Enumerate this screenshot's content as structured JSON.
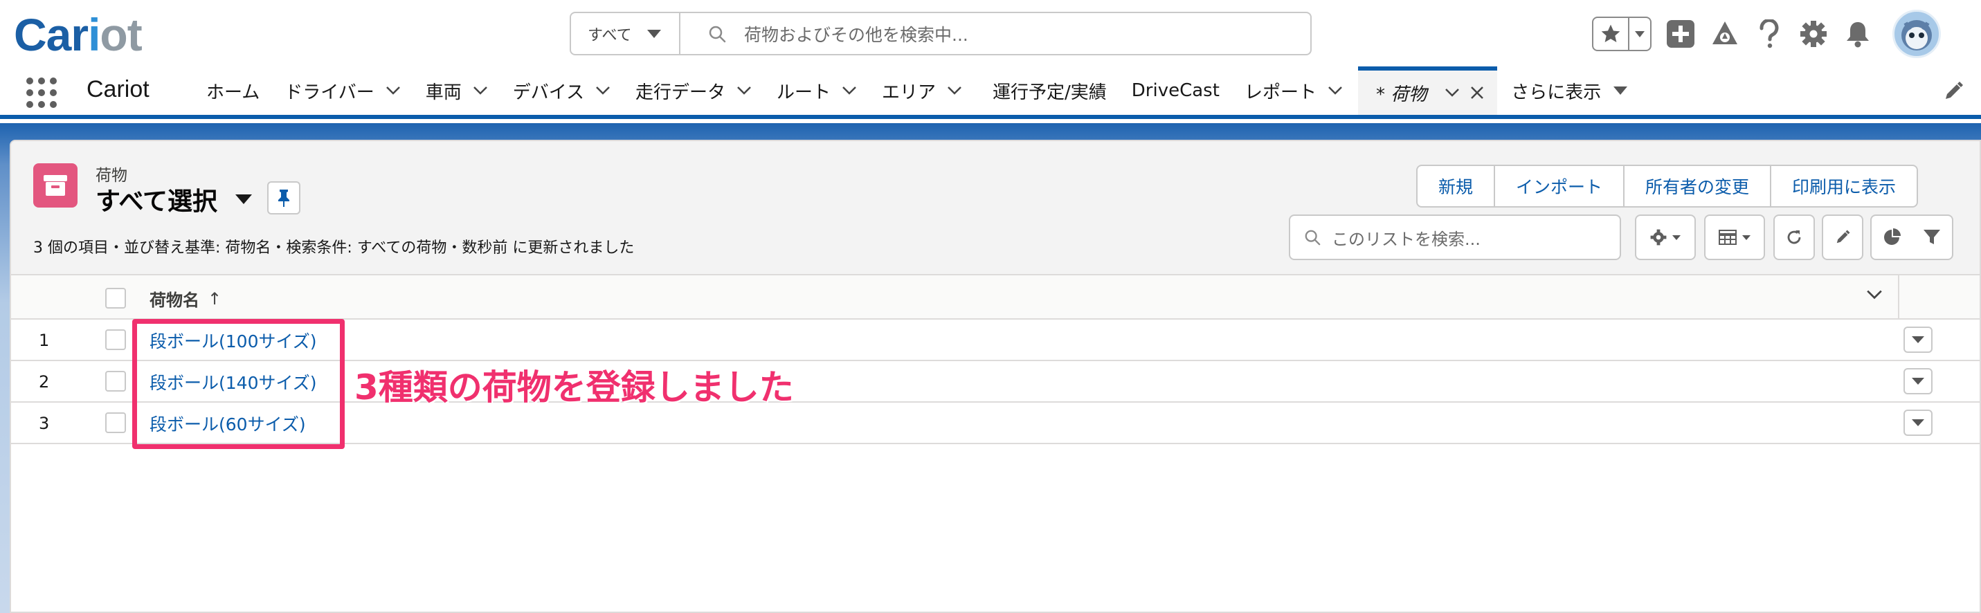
{
  "brand": {
    "logo_a": "Car",
    "logo_b": "i",
    "logo_c": "ot",
    "primary_color": "#0b5cab",
    "accent_color": "#e3567f"
  },
  "global_search": {
    "scope": "すべて",
    "placeholder": "荷物およびその他を検索中..."
  },
  "header_icons": [
    "star-icon",
    "add-icon",
    "trailhead-icon",
    "help-icon",
    "gear-icon",
    "bell-icon",
    "avatar"
  ],
  "nav": {
    "app_name": "Cariot",
    "items": [
      {
        "label": "ホーム",
        "has_menu": false
      },
      {
        "label": "ドライバー",
        "has_menu": true
      },
      {
        "label": "車両",
        "has_menu": true
      },
      {
        "label": "デバイス",
        "has_menu": true
      },
      {
        "label": "走行データ",
        "has_menu": true
      },
      {
        "label": "ルート",
        "has_menu": true
      },
      {
        "label": "エリア",
        "has_menu": true
      },
      {
        "label": "運行予定/実績",
        "has_menu": false
      },
      {
        "label": "DriveCast",
        "has_menu": false
      },
      {
        "label": "レポート",
        "has_menu": true
      }
    ],
    "active_tab": "* 荷物",
    "more": "さらに表示"
  },
  "list_view": {
    "object_label": "荷物",
    "view_name": "すべて選択",
    "summary": "3 個の項目・並び替え基準: 荷物名・検索条件: すべての荷物・数秒前 に更新されました",
    "buttons": [
      "新規",
      "インポート",
      "所有者の変更",
      "印刷用に表示"
    ],
    "search_placeholder": "このリストを検索...",
    "column_header": "荷物名",
    "sort_indicator": "↑",
    "rows": [
      {
        "num": "1",
        "name": "段ボール(100サイズ)"
      },
      {
        "num": "2",
        "name": "段ボール(140サイズ)"
      },
      {
        "num": "3",
        "name": "段ボール(60サイズ)"
      }
    ]
  },
  "annotation": {
    "text": "3種類の荷物を登録しました",
    "color": "#f0306e"
  }
}
